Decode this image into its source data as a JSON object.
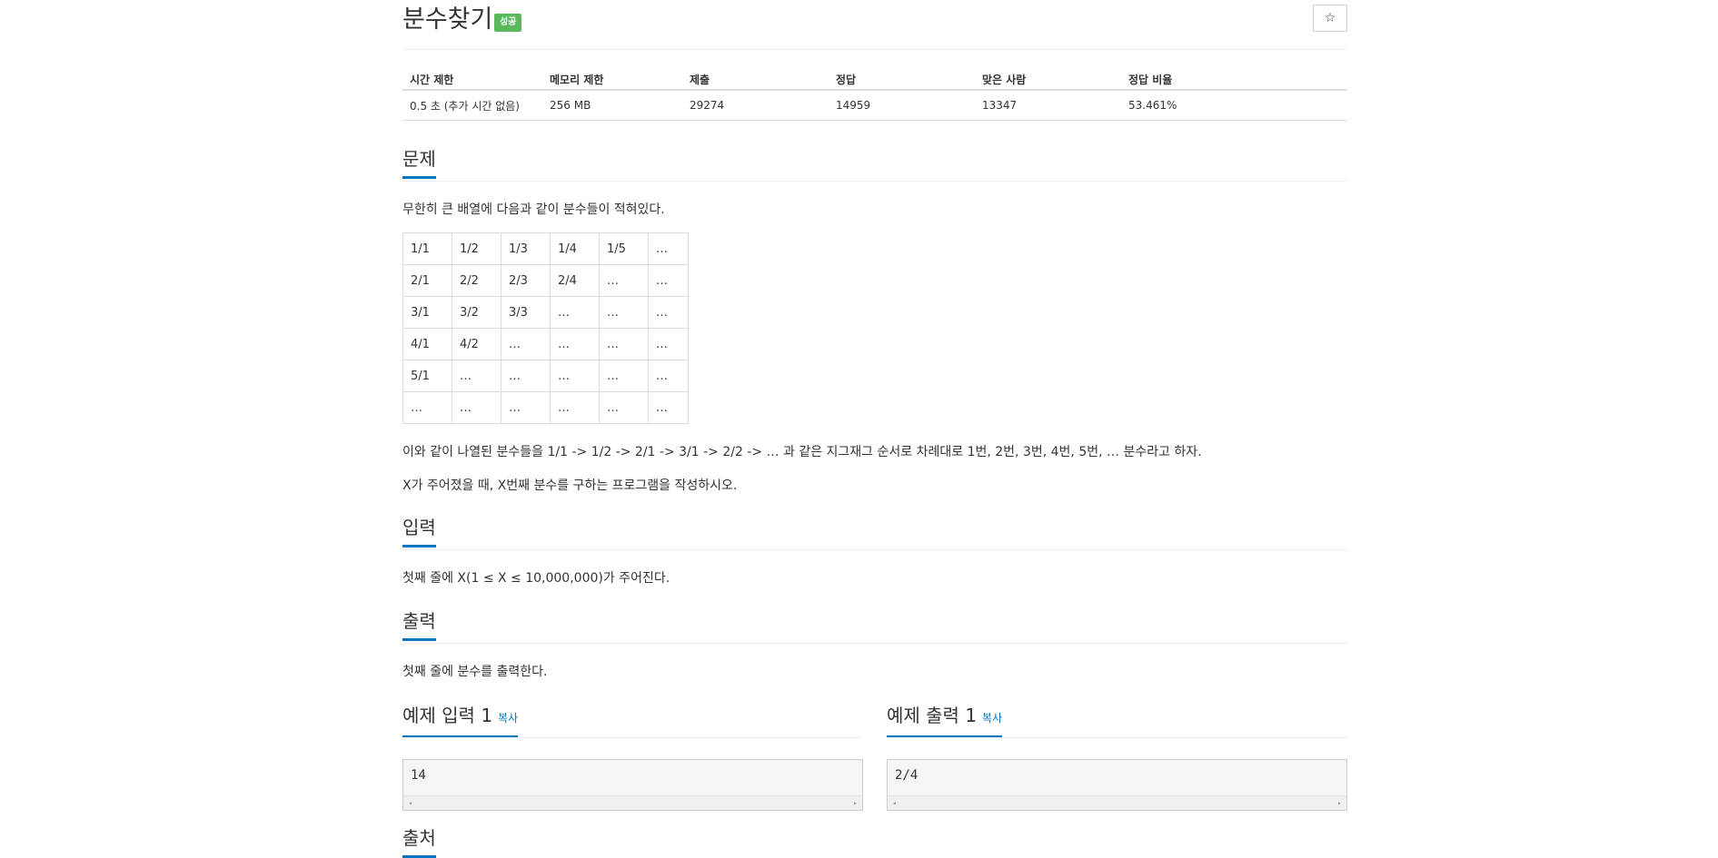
{
  "problem": {
    "title": "분수찾기",
    "badge": "성공",
    "star": "☆"
  },
  "info": {
    "headers": [
      "시간 제한",
      "메모리 제한",
      "제출",
      "정답",
      "맞은 사람",
      "정답 비율"
    ],
    "values": [
      "0.5 초 (추가 시간 없음)",
      "256 MB",
      "29274",
      "14959",
      "13347",
      "53.461%"
    ]
  },
  "sections": {
    "problem": "문제",
    "input": "입력",
    "output": "출력",
    "sample_input": "예제 입력 1",
    "sample_output": "예제 출력 1",
    "source": "출처",
    "copy": "복사"
  },
  "description": {
    "intro": "무한히 큰 배열에 다음과 같이 분수들이 적혀있다.",
    "order": "이와 같이 나열된 분수들을 1/1 -> 1/2 -> 2/1 -> 3/1 -> 2/2 -> … 과 같은 지그재그 순서로 차례대로 1번, 2번, 3번, 4번, 5번, … 분수라고 하자.",
    "task": "X가 주어졌을 때, X번째 분수를 구하는 프로그램을 작성하시오."
  },
  "grid": [
    [
      "1/1",
      "1/2",
      "1/3",
      "1/4",
      "1/5",
      "…"
    ],
    [
      "2/1",
      "2/2",
      "2/3",
      "2/4",
      "…",
      "…"
    ],
    [
      "3/1",
      "3/2",
      "3/3",
      "…",
      "…",
      "…"
    ],
    [
      "4/1",
      "4/2",
      "…",
      "…",
      "…",
      "…"
    ],
    [
      "5/1",
      "…",
      "…",
      "…",
      "…",
      "…"
    ],
    [
      "…",
      "…",
      "…",
      "…",
      "…",
      "…"
    ]
  ],
  "input_text": "첫째 줄에 X(1 ≤ X ≤ 10,000,000)가 주어진다.",
  "output_text": "첫째 줄에 분수를 출력한다.",
  "sample_input_value": "14",
  "sample_output_value": "2/4",
  "icons": {
    "scroll_left": "◂",
    "scroll_right": "▸"
  }
}
